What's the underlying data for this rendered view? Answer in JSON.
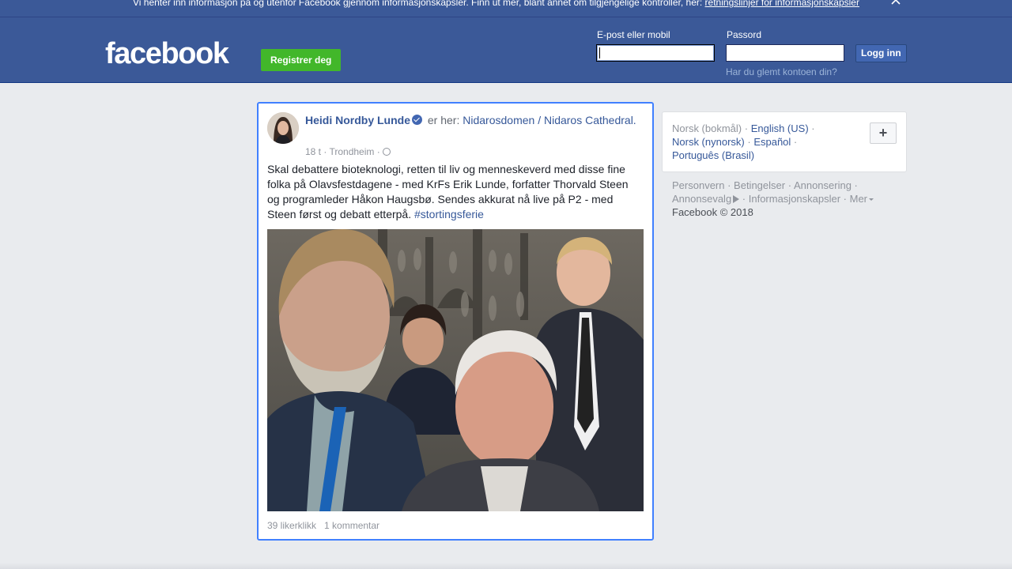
{
  "cookie_banner": {
    "text": "Vi henter inn informasjon på og utenfor Facebook gjennom informasjonskapsler. Finn ut mer, blant annet om tilgjengelige kontroller, her:",
    "link": "retningslinjer for informasjonskapsler",
    "close_icon": "close-icon"
  },
  "header": {
    "logo": "facebook",
    "register_label": "Registrer deg",
    "email_label": "E-post eller mobil",
    "email_value": "",
    "password_label": "Passord",
    "password_value": "",
    "login_label": "Logg inn",
    "forgot_label": "Har du glemt kontoen din?"
  },
  "post": {
    "author": "Heidi Nordby Lunde",
    "verified_icon": "verified-badge-icon",
    "at_text": "er her:",
    "place": "Nidarosdomen / Nidaros Cathedral.",
    "time": "18 t",
    "location": "Trondheim",
    "privacy_icon": "globe-icon",
    "text": "Skal debattere bioteknologi, retten til liv og menneskeverd med disse fine folka på Olavsfestdagene - med KrFs Erik Lunde, forfatter Thorvald Steen og programleder Håkon Haugsbø. Sendes akkurat nå live på P2 - med Steen først og debatt etterpå.",
    "hashtag": "#stortingsferie",
    "likes": "39 likerklikk",
    "comments": "1 kommentar"
  },
  "languages": {
    "current": "Norsk (bokmål)",
    "options": [
      "English (US)",
      "Norsk (nynorsk)",
      "Español",
      "Português (Brasil)"
    ],
    "more_icon": "plus-icon"
  },
  "footer": {
    "links": [
      "Personvern",
      "Betingelser",
      "Annonsering",
      "Annonsevalg",
      "Informasjonskapsler",
      "Mer"
    ],
    "copyright": "Facebook © 2018"
  }
}
